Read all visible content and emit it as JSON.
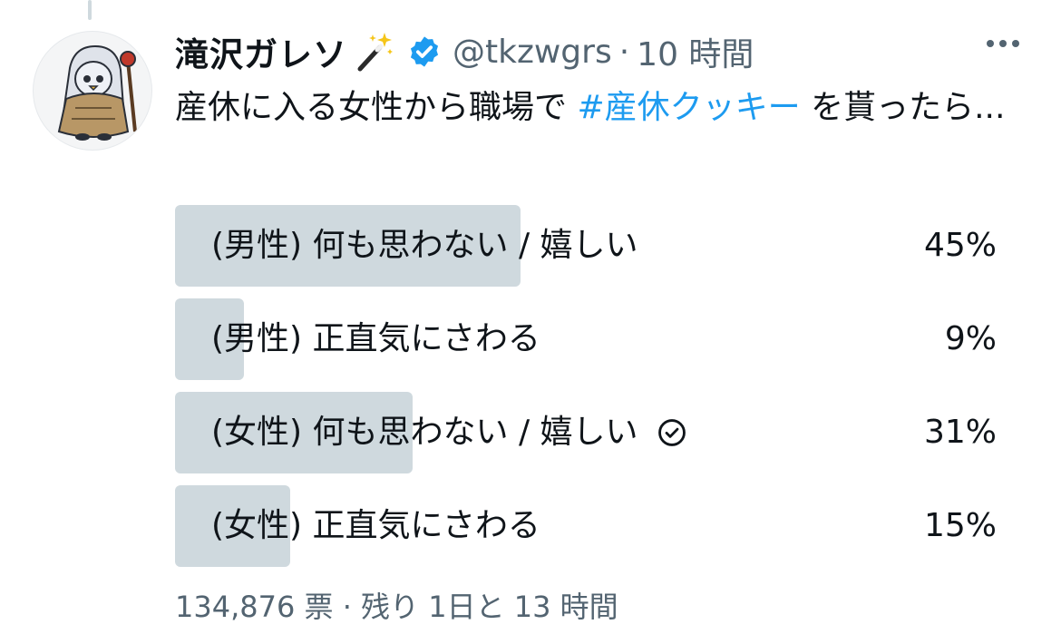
{
  "tweet": {
    "author_name": "滝沢ガレソ",
    "handle": "@tkzwgrs",
    "separator": "·",
    "time_ago": "10 時間",
    "text_before": "産休に入る女性から職場で ",
    "hashtag": "#産休クッキー",
    "text_after": " を貰ったら..."
  },
  "poll": {
    "options": [
      {
        "label": "(男性) 何も思わない / 嬉しい",
        "percent_text": "45%",
        "percent": 45,
        "selected": false
      },
      {
        "label": "(男性) 正直気にさわる",
        "percent_text": "9%",
        "percent": 9,
        "selected": false
      },
      {
        "label": "(女性) 何も思わない / 嬉しい",
        "percent_text": "31%",
        "percent": 31,
        "selected": true
      },
      {
        "label": "(女性) 正直気にさわる",
        "percent_text": "15%",
        "percent": 15,
        "selected": false
      }
    ],
    "votes": "134,876 票",
    "meta_separator": "·",
    "remaining": "残り 1日と 13 時間"
  },
  "icons": {
    "avatar": "character-avatar",
    "emoji": "magic-wand-sparkles-icon",
    "verified": "verified-badge-icon",
    "more": "more-dots-icon",
    "selected": "circle-check-icon"
  },
  "colors": {
    "text": "#0f1419",
    "secondary": "#536471",
    "link": "#1d9bf0",
    "bar": "#cfd9de"
  }
}
